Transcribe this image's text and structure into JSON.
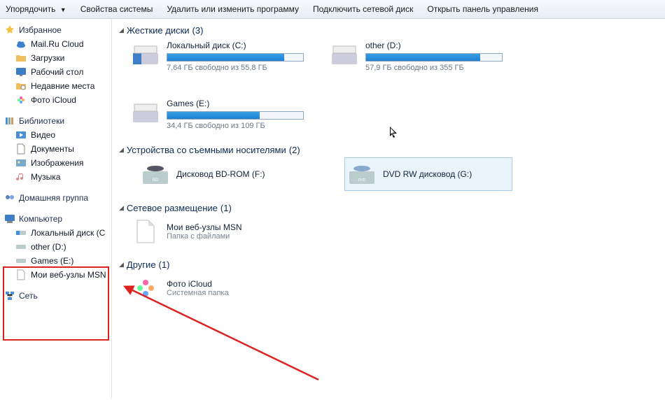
{
  "toolbar": {
    "organize": "Упорядочить",
    "props": "Свойства системы",
    "uninstall": "Удалить или изменить программу",
    "map_drive": "Подключить сетевой диск",
    "open_cp": "Открыть панель управления"
  },
  "sidebar": {
    "favorites": {
      "title": "Избранное",
      "items": [
        "Mail.Ru Cloud",
        "Загрузки",
        "Рабочий стол",
        "Недавние места",
        "Фото iCloud"
      ]
    },
    "libraries": {
      "title": "Библиотеки",
      "items": [
        "Видео",
        "Документы",
        "Изображения",
        "Музыка"
      ]
    },
    "homegroup": "Домашняя группа",
    "computer": {
      "title": "Компьютер",
      "items": [
        "Локальный диск (C",
        "other (D:)",
        "Games (E:)",
        "Мои веб-узлы MSN"
      ]
    },
    "network": "Сеть"
  },
  "categories": {
    "hdd": {
      "label": "Жесткие диски",
      "count": 3
    },
    "removable": {
      "label": "Устройства со съемными носителями",
      "count": 2
    },
    "netloc": {
      "label": "Сетевое размещение",
      "count": 1
    },
    "other": {
      "label": "Другие",
      "count": 1
    }
  },
  "drives": {
    "c": {
      "name": "Локальный диск (C:)",
      "sub": "7,64 ГБ свободно из 55,8 ГБ",
      "fill": 86
    },
    "d": {
      "name": "other (D:)",
      "sub": "57,9 ГБ свободно из 355 ГБ",
      "fill": 84
    },
    "e": {
      "name": "Games (E:)",
      "sub": "34,4 ГБ свободно из 109 ГБ",
      "fill": 68
    },
    "bd": {
      "name": "Дисковод BD-ROM (F:)"
    },
    "dvd": {
      "name": "DVD RW дисковод (G:)"
    },
    "msn": {
      "name": "Мои веб-узлы MSN",
      "sub": "Папка с файлами"
    },
    "icloud": {
      "name": "Фото iCloud",
      "sub": "Системная папка"
    }
  }
}
